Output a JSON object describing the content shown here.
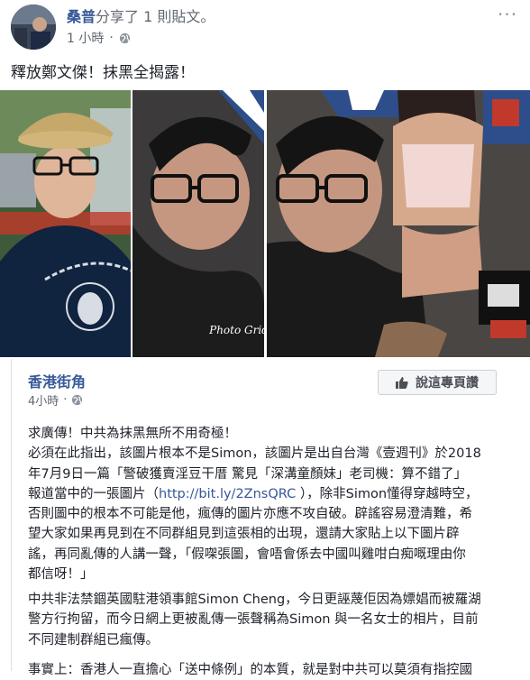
{
  "post": {
    "sharer_name": "桑普",
    "share_action": "分享了 1 則貼文。",
    "time": "1 小時",
    "more_label": "···",
    "text": "釋放鄭文傑！抹黑全揭露！"
  },
  "photos": {
    "watermark": "Photo Grid"
  },
  "shared": {
    "page_name": "香港街角",
    "time": "4小時",
    "like_label": "說這專頁讚",
    "paragraph1": [
      "求廣傳！中共為抹黑無所不用奇極！",
      "必須在此指出，該圖片根本不是Simon，該圖片是出自台灣《壹週刊》於2018",
      "年7月9日一篇「警破獲賣淫豆干厝 驚見「深溝童顏妹」老司機：算不錯了」"
    ],
    "p1_line4_before": "報道當中的一張圖片（",
    "p1_link": "http://bit.ly/2ZnsQRC",
    "p1_line4_after": " ），除非Simon懂得穿越時空，",
    "paragraph1_rest": [
      "否則圖中的根本不可能是他，瘋傳的圖片亦應不攻自破。辟謠容易澄清難，希",
      "望大家如果再見到在不同群組見到這張相的出現，還請大家貼上以下圖片辟",
      "謠，再同亂傳的人講一聲，「假㗎張圖，會唔會係去中國叫雞咁白痴嘅理由你",
      "都信呀！」"
    ],
    "paragraph2": [
      "中共非法禁錮英國駐港領事館Simon Cheng，今日更誣蔑佢因為嫖娼而被羅湖",
      "警方行拘留，而今日網上更被亂傳一張聲稱為Simon 與一名女士的相片，目前",
      "不同建制群組已瘋傳。"
    ],
    "paragraph3_partial": "事實上：香港人一直擔心「送中條例」的本質，就是對中共可以莫須有指控國"
  }
}
